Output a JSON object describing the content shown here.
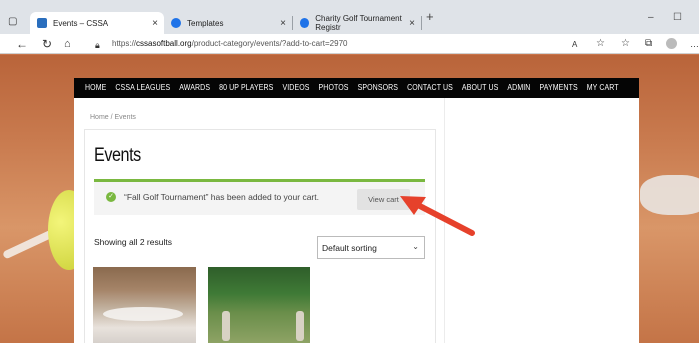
{
  "browser": {
    "tabs": [
      {
        "label": "Events – CSSA"
      },
      {
        "label": "Templates"
      },
      {
        "label": "Charity Golf Tournament Registr"
      }
    ],
    "url": "https://cssasoftball.org/product-category/events/?add-to-cart=2970",
    "url_prefix": "https://",
    "url_host": "cssasoftball.org",
    "url_path": "/product-category/events/?add-to-cart=2970",
    "new_tab": "+",
    "tab_close": "×"
  },
  "nav": {
    "items": [
      "HOME",
      "CSSA LEAGUES",
      "AWARDS",
      "80 UP PLAYERS",
      "VIDEOS",
      "PHOTOS",
      "SPONSORS",
      "CONTACT US",
      "ABOUT US",
      "ADMIN",
      "PAYMENTS",
      "MY CART"
    ]
  },
  "breadcrumb": "Home / Events",
  "page_title": "Events",
  "notice": {
    "text": "“Fall Golf Tournament” has been added to your cart.",
    "button_label": "View cart",
    "color": "#7ab840"
  },
  "results_count": "Showing all 2 results",
  "sort": {
    "selected": "Default sorting"
  },
  "annotation": {
    "arrow_color": "#e6412b"
  }
}
